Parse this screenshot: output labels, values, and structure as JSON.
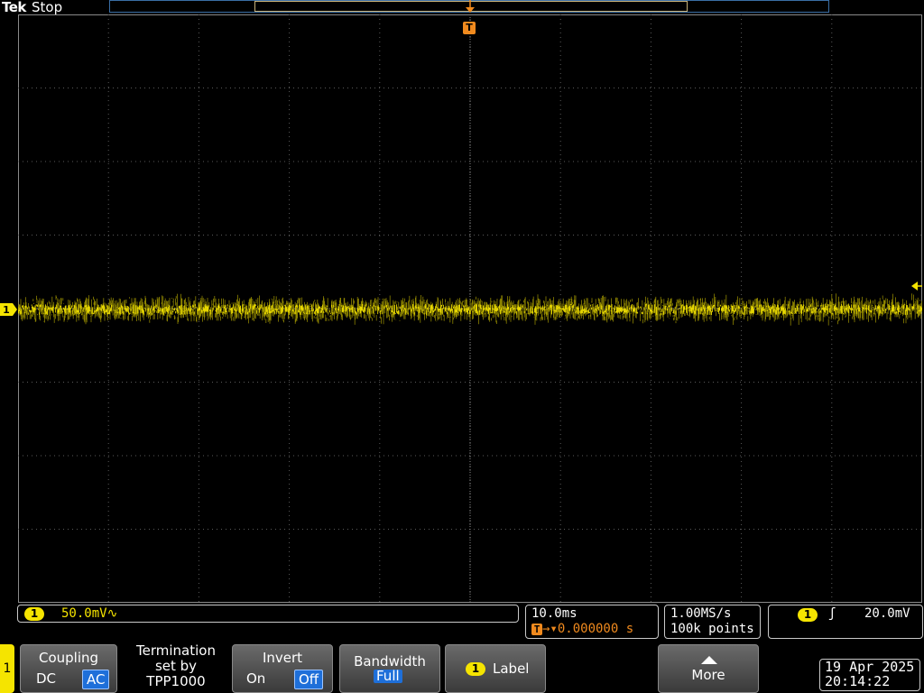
{
  "header": {
    "brand": "Tek",
    "acquisition_state": "Stop"
  },
  "colors": {
    "channel1": "#f5e400",
    "trigger": "#f08a1e",
    "grid": "#5a5a5a",
    "selected": "#1e6fd9"
  },
  "markers": {
    "trigger_position": "T",
    "channel": "1"
  },
  "readouts": {
    "channel": {
      "number": "1",
      "scale": "50.0mV∿"
    },
    "timebase": {
      "scale": "10.0ms",
      "trigger_delay": "0.000000 s"
    },
    "acquisition": {
      "sample_rate": "1.00MS/s",
      "record_length": "100k points"
    },
    "trigger": {
      "source": "1",
      "slope": "ʃ",
      "level": "20.0mV"
    }
  },
  "menu": {
    "channel_tab": "1",
    "coupling": {
      "title": "Coupling",
      "options": [
        "DC",
        "AC"
      ],
      "selected": "AC"
    },
    "termination": {
      "line1": "Termination",
      "line2": "set by",
      "line3": "TPP1000"
    },
    "invert": {
      "title": "Invert",
      "options": [
        "On",
        "Off"
      ],
      "selected": "Off"
    },
    "bandwidth": {
      "title": "Bandwidth",
      "value": "Full"
    },
    "label": {
      "badge": "1",
      "title": "Label"
    },
    "more": {
      "title": "More"
    }
  },
  "datetime": {
    "date": "19 Apr 2025",
    "time": "20:14:22"
  }
}
